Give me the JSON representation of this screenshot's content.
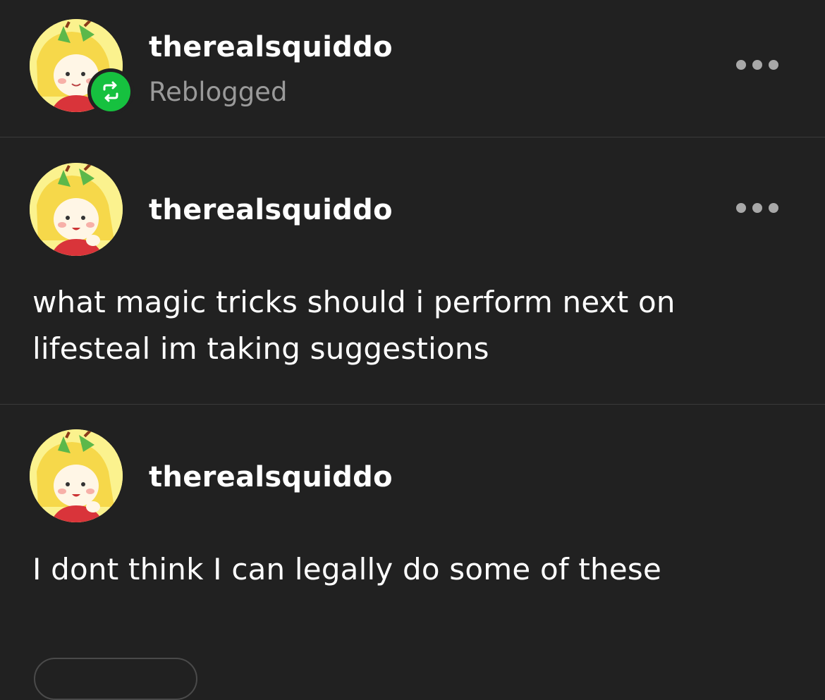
{
  "reblog_header": {
    "username": "therealsquiddo",
    "status": "Reblogged",
    "avatar_icon": "avatar-image",
    "badge_icon": "reblog-icon",
    "badge_color": "#16c13f",
    "more_icon": "more-options-icon"
  },
  "posts": [
    {
      "username": "therealsquiddo",
      "text": "what magic tricks should i perform next on lifesteal im taking suggestions",
      "more_icon": "more-options-icon"
    },
    {
      "username": "therealsquiddo",
      "text": "I dont think I can legally do some of these"
    }
  ],
  "colors": {
    "background": "#212121",
    "divider": "#3a3a3a",
    "text": "#ffffff",
    "muted": "#9a9a9a"
  }
}
